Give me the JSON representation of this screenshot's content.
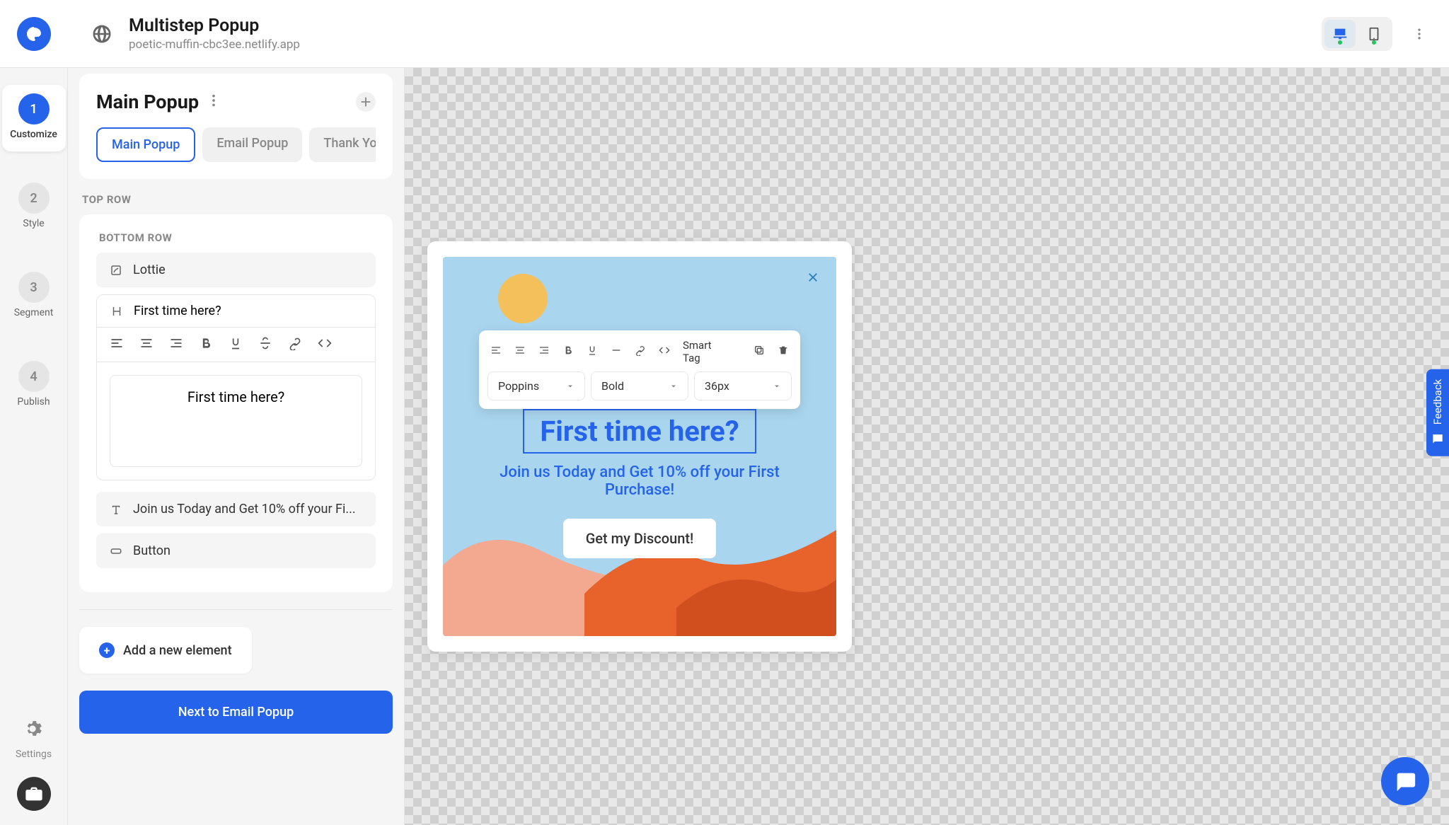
{
  "header": {
    "title": "Multistep Popup",
    "subtitle": "poetic-muffin-cbc3ee.netlify.app"
  },
  "steps": [
    {
      "num": "1",
      "label": "Customize"
    },
    {
      "num": "2",
      "label": "Style"
    },
    {
      "num": "3",
      "label": "Segment"
    },
    {
      "num": "4",
      "label": "Publish"
    }
  ],
  "settings_label": "Settings",
  "panel": {
    "title": "Main Popup",
    "tabs": [
      "Main Popup",
      "Email Popup",
      "Thank Yo"
    ],
    "top_row_label": "TOP ROW",
    "bottom_row_label": "BOTTOM ROW",
    "lottie_label": "Lottie",
    "heading_item": "First time here?",
    "heading_value": "First time here?",
    "text_item": "Join us Today and Get 10% off your Fi...",
    "button_item": "Button",
    "add_element": "Add a new element",
    "next_button": "Next to Email Popup"
  },
  "popup": {
    "heading": "First time here?",
    "subheading": "Join us Today and Get 10% off your First Purchase!",
    "cta": "Get my Discount!"
  },
  "toolbar": {
    "smart_tag": "Smart Tag",
    "font": "Poppins",
    "weight": "Bold",
    "size": "36px"
  },
  "feedback": "Feedback"
}
